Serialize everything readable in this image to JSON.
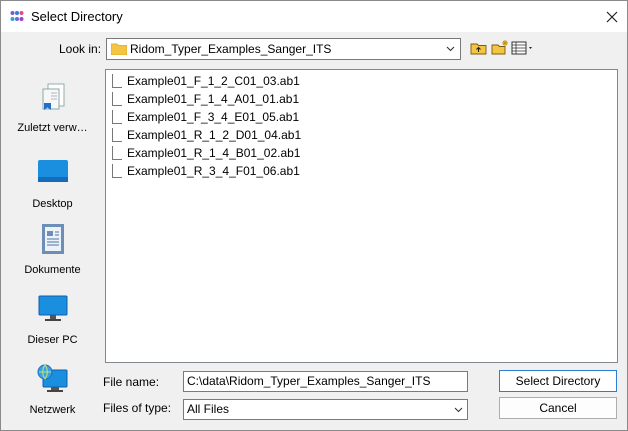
{
  "window": {
    "title": "Select Directory"
  },
  "lookin": {
    "label": "Look in:",
    "value": "Ridom_Typer_Examples_Sanger_ITS"
  },
  "toolbar": {
    "up": "up-folder-icon",
    "new_folder": "new-folder-icon",
    "view": "view-menu-icon"
  },
  "places": [
    {
      "label": "Zuletzt verw…",
      "icon": "recent-icon"
    },
    {
      "label": "Desktop",
      "icon": "desktop-icon"
    },
    {
      "label": "Dokumente",
      "icon": "documents-icon"
    },
    {
      "label": "Dieser PC",
      "icon": "computer-icon"
    },
    {
      "label": "Netzwerk",
      "icon": "network-icon"
    }
  ],
  "files": [
    "Example01_F_1_2_C01_03.ab1",
    "Example01_F_1_4_A01_01.ab1",
    "Example01_F_3_4_E01_05.ab1",
    "Example01_R_1_2_D01_04.ab1",
    "Example01_R_1_4_B01_02.ab1",
    "Example01_R_3_4_F01_06.ab1"
  ],
  "filename": {
    "label": "File name:",
    "value": "C:\\data\\Ridom_Typer_Examples_Sanger_ITS"
  },
  "filetype": {
    "label": "Files of type:",
    "value": "All Files"
  },
  "buttons": {
    "select": "Select Directory",
    "cancel": "Cancel"
  },
  "colors": {
    "accent": "#2f7dd3",
    "folder": "#f4c542"
  }
}
